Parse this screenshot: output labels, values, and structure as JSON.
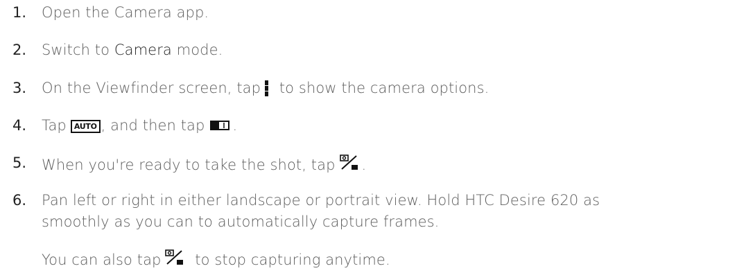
{
  "steps": [
    {
      "num": "1.",
      "text": "Open the Camera app."
    },
    {
      "num": "2.",
      "before": "Switch to ",
      "bold": "Camera",
      "after": " mode."
    },
    {
      "num": "3.",
      "before": "On the Viewfinder screen, tap",
      "after": "to show the camera options.",
      "icon": "menu-dots-icon"
    },
    {
      "num": "4.",
      "before": "Tap",
      "icon_label": "AUTO",
      "middle": ", and then tap",
      "after": ".",
      "icons": [
        "auto-mode-icon",
        "panorama-icon"
      ]
    },
    {
      "num": "5.",
      "before": "When you're ready to take the shot, tap",
      "after": ".",
      "icon": "shutter-icon"
    },
    {
      "num": "6.",
      "line1": "Pan left or right in either landscape or portrait view. Hold HTC Desire 620 as",
      "line2": "smoothly as you can to automatically capture frames."
    }
  ],
  "note": {
    "before": "You can also tap",
    "after": "to stop capturing anytime.",
    "icon": "shutter-icon"
  }
}
